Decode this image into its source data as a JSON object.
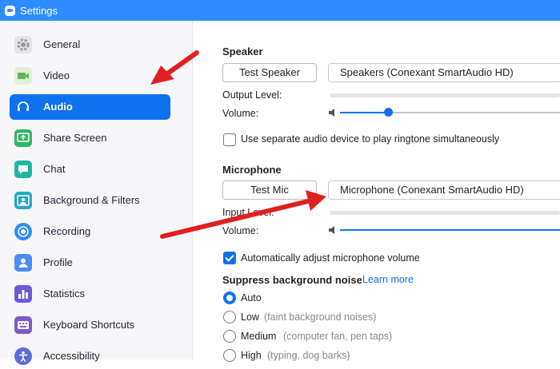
{
  "window": {
    "title": "Settings"
  },
  "sidebar": {
    "items": [
      {
        "label": "General",
        "icon": "gear-icon",
        "color": "#e1e1e6",
        "active": false
      },
      {
        "label": "Video",
        "icon": "video-camera-icon",
        "color": "#e1f0d8",
        "active": false
      },
      {
        "label": "Audio",
        "icon": "headphones-icon",
        "color": "#0e72ed",
        "active": true
      },
      {
        "label": "Share Screen",
        "icon": "share-screen-icon",
        "color": "#31b665",
        "active": false
      },
      {
        "label": "Chat",
        "icon": "chat-bubble-icon",
        "color": "#1fb7a2",
        "active": false
      },
      {
        "label": "Background & Filters",
        "icon": "person-background-icon",
        "color": "#2aa8c4",
        "active": false
      },
      {
        "label": "Recording",
        "icon": "record-icon",
        "color": "#2d8cff",
        "active": false
      },
      {
        "label": "Profile",
        "icon": "profile-icon",
        "color": "#4a8df6",
        "active": false
      },
      {
        "label": "Statistics",
        "icon": "statistics-icon",
        "color": "#6e57d8",
        "active": false
      },
      {
        "label": "Keyboard Shortcuts",
        "icon": "keyboard-icon",
        "color": "#7d59c9",
        "active": false
      },
      {
        "label": "Accessibility",
        "icon": "accessibility-icon",
        "color": "#5b6bd9",
        "active": false
      }
    ]
  },
  "speaker": {
    "title": "Speaker",
    "test_button": "Test Speaker",
    "device": "Speakers (Conexant SmartAudio HD)",
    "output_level_label": "Output Level:",
    "volume_label": "Volume:",
    "volume_level": 0.22
  },
  "ringtone": {
    "label": "Use separate audio device to play ringtone simultaneously",
    "checked": false
  },
  "microphone": {
    "title": "Microphone",
    "test_button": "Test Mic",
    "device": "Microphone (Conexant SmartAudio HD)",
    "input_level_label": "Input Level:",
    "volume_label": "Volume:",
    "auto_adjust_label": "Automatically adjust microphone volume",
    "auto_adjust_checked": true
  },
  "noise": {
    "title": "Suppress background noise",
    "learn_more": "Learn more",
    "options": [
      {
        "label": "Auto",
        "hint": "",
        "checked": true
      },
      {
        "label": "Low",
        "hint": "(faint background noises)",
        "checked": false
      },
      {
        "label": "Medium",
        "hint": "(computer fan, pen taps)",
        "checked": false
      },
      {
        "label": "High",
        "hint": "(typing, dog barks)",
        "checked": false
      }
    ]
  },
  "annotations": {
    "arrow_color": "#e02020"
  }
}
